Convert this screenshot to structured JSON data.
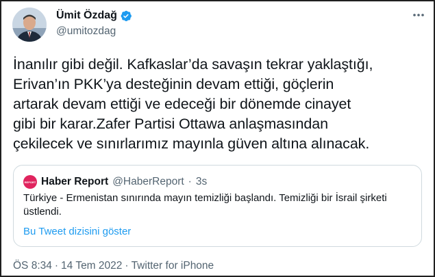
{
  "author": {
    "name": "Ümit Özdağ",
    "handle": "@umitozdag"
  },
  "icons": {
    "verified": "verified-badge-icon",
    "more": "more-options-icon"
  },
  "colors": {
    "accent": "#1d9bf0",
    "secondary_text": "#536471",
    "quote_logo": "#e0245e"
  },
  "tweet": {
    "text": "İnanılır gibi değil. Kafkaslar’da savaşın tekrar yaklaştığı,\nErivan’ın PKK’ya desteğinin devam ettiği, göçlerin\nartarak devam ettiği ve edeceği bir dönemde cinayet\ngibi bir karar.Zafer Partisi Ottawa anlaşmasından\nçekilecek ve sınırlarımız mayınla güven altına alınacak."
  },
  "quote": {
    "logo_text": "REPORT",
    "name": "Haber Report",
    "handle": "@HaberReport",
    "separator": "·",
    "time": "3s",
    "text": "Türkiye - Ermenistan sınırında mayın temizliği başlandı. Temizliği bir İsrail şirketi üstlendi.",
    "link": "Bu Tweet dizisini göster"
  },
  "footer": {
    "time": "ÖS 8:34",
    "separator1": "·",
    "date": "14 Tem 2022",
    "separator2": "·",
    "client": "Twitter for iPhone"
  }
}
